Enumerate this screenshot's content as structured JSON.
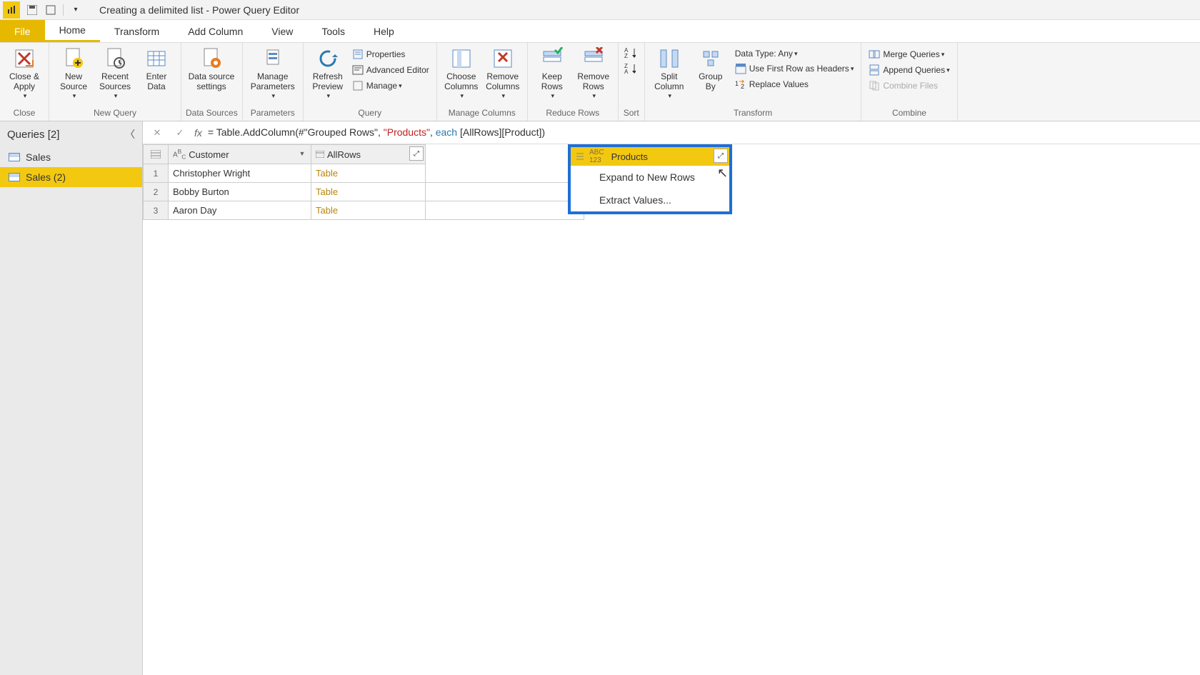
{
  "title": "Creating a delimited list - Power Query Editor",
  "tabs": {
    "file": "File",
    "home": "Home",
    "transform": "Transform",
    "addcolumn": "Add Column",
    "view": "View",
    "tools": "Tools",
    "help": "Help"
  },
  "ribbon": {
    "close": {
      "closeApply": "Close &\nApply",
      "group": "Close"
    },
    "newquery": {
      "newSource": "New\nSource",
      "recent": "Recent\nSources",
      "enter": "Enter\nData",
      "group": "New Query"
    },
    "datasources": {
      "settings": "Data source\nsettings",
      "group": "Data Sources"
    },
    "parameters": {
      "manage": "Manage\nParameters",
      "group": "Parameters"
    },
    "query": {
      "refresh": "Refresh\nPreview",
      "properties": "Properties",
      "advanced": "Advanced Editor",
      "manage": "Manage",
      "group": "Query"
    },
    "managecols": {
      "choose": "Choose\nColumns",
      "remove": "Remove\nColumns",
      "group": "Manage Columns"
    },
    "reducerows": {
      "keep": "Keep\nRows",
      "remove": "Remove\nRows",
      "group": "Reduce Rows"
    },
    "sort": {
      "group": "Sort"
    },
    "transform": {
      "split": "Split\nColumn",
      "group_": "Group\nBy",
      "datatype": "Data Type: Any",
      "firstrow": "Use First Row as Headers",
      "replace": "Replace Values",
      "group": "Transform"
    },
    "combine": {
      "merge": "Merge Queries",
      "append": "Append Queries",
      "combinefiles": "Combine Files",
      "group": "Combine"
    }
  },
  "sidebar": {
    "header": "Queries [2]",
    "items": [
      "Sales",
      "Sales (2)"
    ]
  },
  "formula": {
    "prefix": "= Table.AddColumn(#\"Grouped Rows\", ",
    "str": "\"Products\"",
    "mid": ", ",
    "kw": "each",
    "suffix": " [AllRows][Product])"
  },
  "grid": {
    "columns": {
      "customer": "Customer",
      "allrows": "AllRows",
      "products": "Products"
    },
    "rows": [
      {
        "n": "1",
        "customer": "Christopher Wright",
        "allrows": "Table"
      },
      {
        "n": "2",
        "customer": "Bobby Burton",
        "allrows": "Table"
      },
      {
        "n": "3",
        "customer": "Aaron Day",
        "allrows": "Table"
      }
    ]
  },
  "menu": {
    "expand": "Expand to New Rows",
    "extract": "Extract Values..."
  }
}
